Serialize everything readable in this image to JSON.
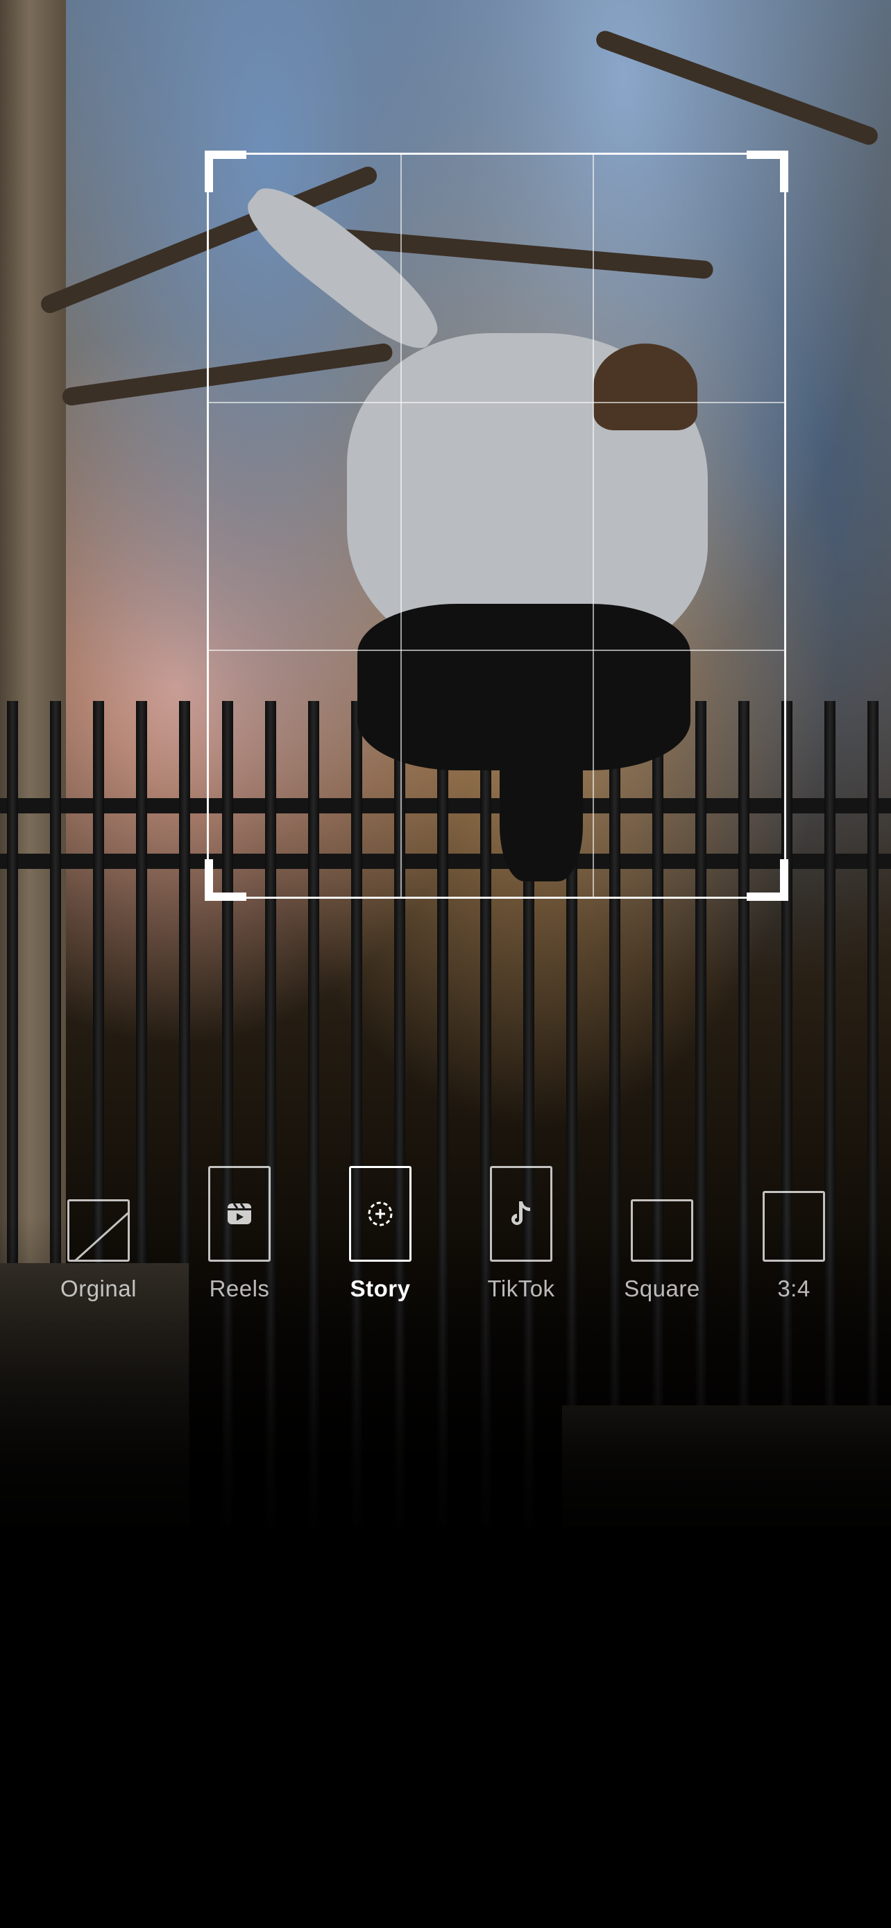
{
  "crop": {
    "grid": "rule-of-thirds",
    "selected_ratio": "Story"
  },
  "ratios": [
    {
      "id": "original",
      "label": "Orginal",
      "icon": "diagonal-square-icon"
    },
    {
      "id": "reels",
      "label": "Reels",
      "icon": "reels-icon"
    },
    {
      "id": "story",
      "label": "Story",
      "icon": "story-add-icon"
    },
    {
      "id": "tiktok",
      "label": "TikTok",
      "icon": "tiktok-icon"
    },
    {
      "id": "square",
      "label": "Square",
      "icon": "square-icon"
    },
    {
      "id": "three-four",
      "label": "3:4",
      "icon": "portrait-rect-icon"
    }
  ],
  "colors": {
    "frame": "#ffffff",
    "label_inactive": "#b8b8b8",
    "label_active": "#ffffff",
    "background": "#000000"
  }
}
